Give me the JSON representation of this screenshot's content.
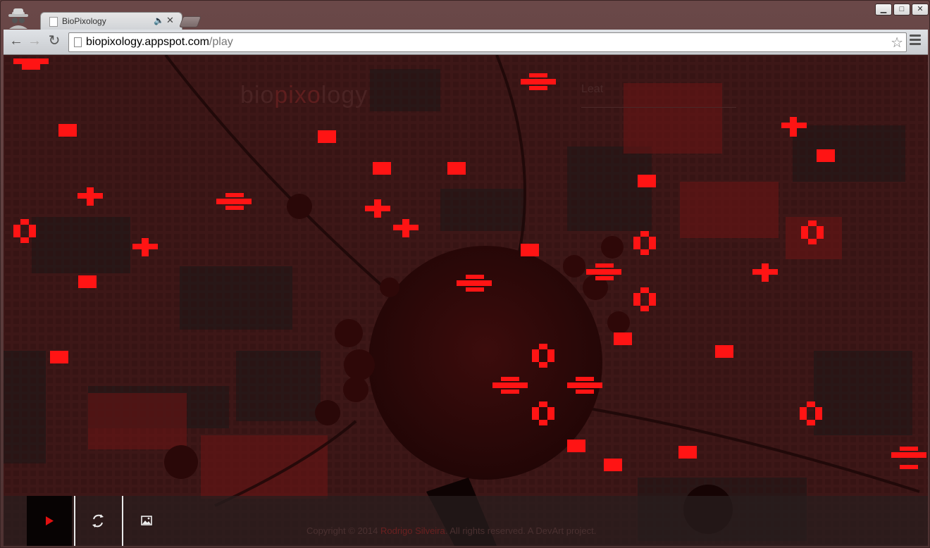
{
  "browser": {
    "tab_title": "BioPixology",
    "tab_close": "✕",
    "tab_speaker": "🔈",
    "url_domain": "biopixology.appspot.com",
    "url_path": "/play",
    "window_controls": {
      "minimize": "▁",
      "maximize": "□",
      "close": "✕"
    }
  },
  "page": {
    "logo_bio": "bio",
    "logo_pixo": "pixo",
    "logo_logy": "logy",
    "search_ghost": "Leat",
    "footer": {
      "copyright_prefix": "Copyright © 2014 ",
      "author": "Rodrigo Silveira",
      "copyright_suffix": ". All rights reserved. A DevArt project."
    },
    "controls": [
      {
        "name": "play",
        "icon": "play-icon"
      },
      {
        "name": "refresh",
        "icon": "refresh-icon"
      },
      {
        "name": "image",
        "icon": "image-icon"
      }
    ]
  },
  "colors": {
    "accent_red": "#ff1a1a",
    "background": "#3a1616",
    "play_triangle": "#e01010"
  }
}
